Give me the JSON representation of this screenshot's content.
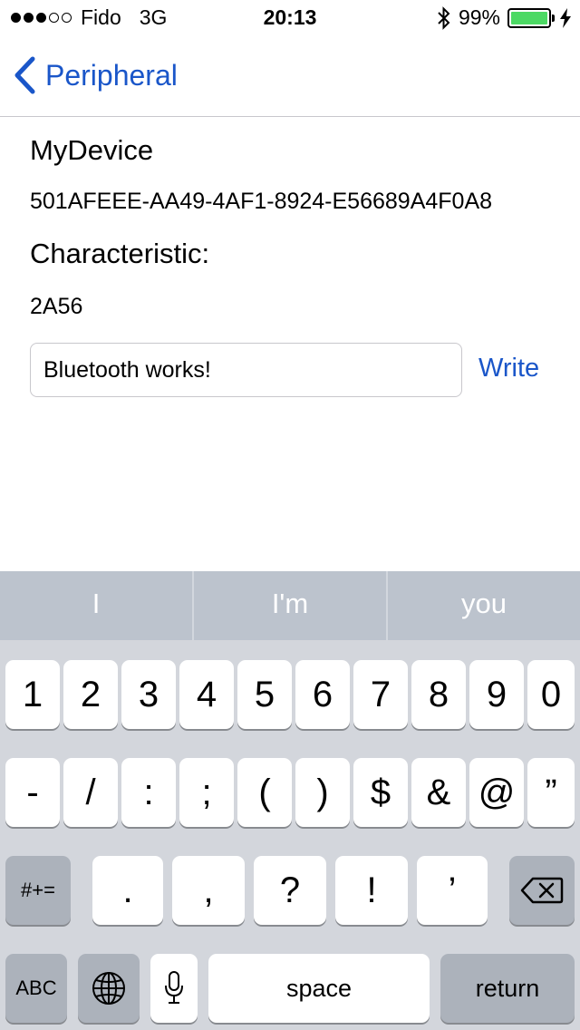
{
  "status_bar": {
    "carrier": "Fido",
    "network": "3G",
    "time": "20:13",
    "battery": "99%",
    "battery_level": 0.99,
    "signal_bars_filled": 3,
    "signal_bars_total": 5
  },
  "nav": {
    "back_label": "Peripheral"
  },
  "content": {
    "device_name": "MyDevice",
    "device_uuid": "501AFEEE-AA49-4AF1-8924-E56689A4F0A8",
    "characteristic_label": "Characteristic:",
    "characteristic_value": "2A56",
    "input_value": "Bluetooth works!",
    "write_label": "Write"
  },
  "suggestions": [
    "I",
    "I'm",
    "you"
  ],
  "keyboard": {
    "row1": [
      "1",
      "2",
      "3",
      "4",
      "5",
      "6",
      "7",
      "8",
      "9",
      "0"
    ],
    "row2": [
      "-",
      "/",
      ":",
      ";",
      "(",
      ")",
      "$",
      "&",
      "@",
      "”"
    ],
    "row3": [
      ".",
      ",",
      "?",
      "!",
      "’"
    ],
    "symbols_label": "#+=",
    "abc_label": "ABC",
    "space_label": "space",
    "return_label": "return"
  },
  "colors": {
    "accent": "#1a56c9",
    "battery": "#4cd964",
    "suggestion_bar": "#bcc3cd",
    "keyboard_bg": "#d3d6dc",
    "dark_key": "#acb2bb"
  }
}
